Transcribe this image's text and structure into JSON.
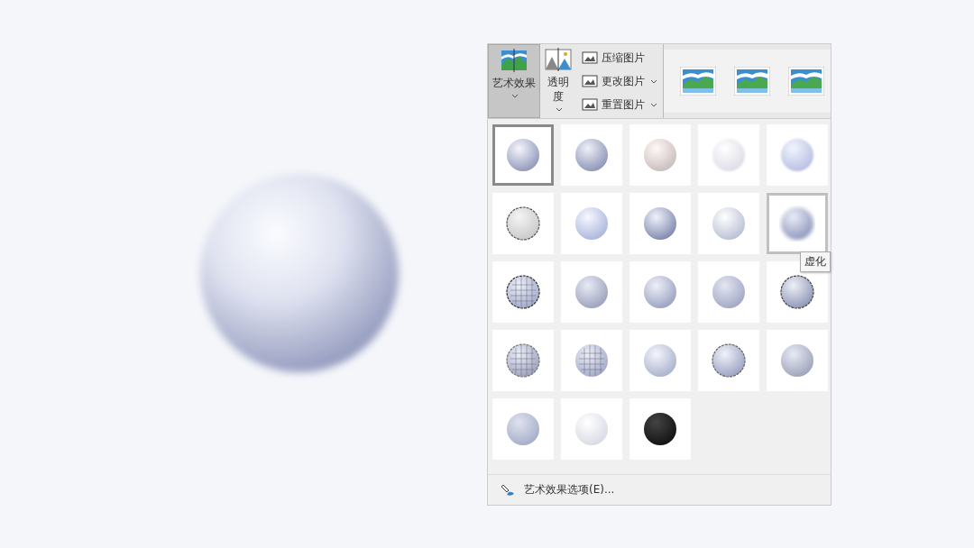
{
  "ribbon": {
    "large_buttons": [
      {
        "label": "艺术效果",
        "selected": true
      },
      {
        "label": "透明度",
        "selected": false
      }
    ],
    "small_buttons": [
      {
        "label": "压缩图片",
        "dropdown": false
      },
      {
        "label": "更改图片",
        "dropdown": true
      },
      {
        "label": "重置图片",
        "dropdown": true
      }
    ],
    "picture_styles": [
      {
        "selected": false
      },
      {
        "selected": false
      },
      {
        "selected": false
      }
    ]
  },
  "effects": [
    {
      "selected": true,
      "hovered": false
    },
    {
      "selected": false,
      "hovered": false
    },
    {
      "selected": false,
      "hovered": false
    },
    {
      "selected": false,
      "hovered": false
    },
    {
      "selected": false,
      "hovered": false
    },
    {
      "selected": false,
      "hovered": false
    },
    {
      "selected": false,
      "hovered": false
    },
    {
      "selected": false,
      "hovered": false
    },
    {
      "selected": false,
      "hovered": false
    },
    {
      "selected": false,
      "hovered": true
    },
    {
      "selected": false,
      "hovered": false
    },
    {
      "selected": false,
      "hovered": false
    },
    {
      "selected": false,
      "hovered": false
    },
    {
      "selected": false,
      "hovered": false
    },
    {
      "selected": false,
      "hovered": false
    },
    {
      "selected": false,
      "hovered": false
    },
    {
      "selected": false,
      "hovered": false
    },
    {
      "selected": false,
      "hovered": false
    },
    {
      "selected": false,
      "hovered": false
    },
    {
      "selected": false,
      "hovered": false
    },
    {
      "selected": false,
      "hovered": false
    },
    {
      "selected": false,
      "hovered": false
    },
    {
      "selected": false,
      "hovered": false
    }
  ],
  "tooltip": {
    "text": "虚化"
  },
  "options_link": {
    "label": "艺术效果选项(E)..."
  }
}
